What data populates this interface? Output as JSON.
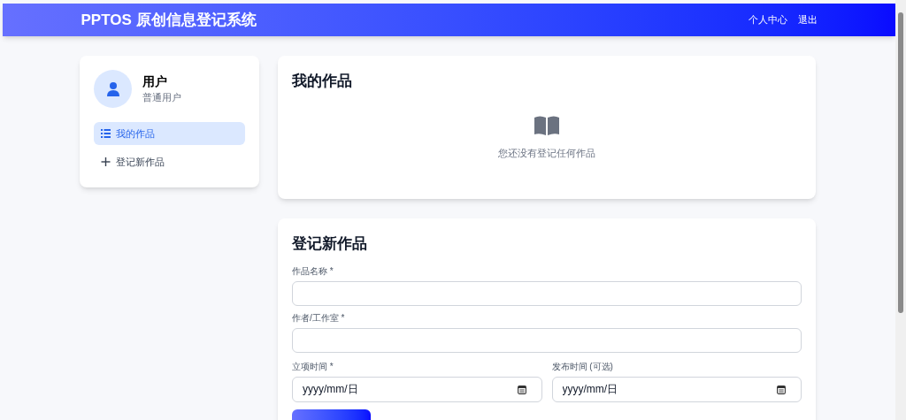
{
  "header": {
    "title": "PPTOS 原创信息登记系统",
    "links": [
      "个人中心",
      "退出"
    ]
  },
  "user": {
    "name": "用户",
    "role": "普通用户"
  },
  "sidebar": {
    "items": [
      {
        "label": "我的作品",
        "kind": "list",
        "selected": true
      },
      {
        "label": "登记新作品",
        "kind": "add",
        "selected": false
      }
    ]
  },
  "works": {
    "title": "我的作品",
    "empty_message": "您还没有登记任何作品"
  },
  "form": {
    "title": "登记新作品",
    "fields": [
      {
        "label": "作品名称 *",
        "kind": "text"
      },
      {
        "label": "作者/工作室 *",
        "kind": "text"
      }
    ],
    "dates": [
      {
        "label": "立项时间 *",
        "placeholder": "yyyy/mm/日"
      },
      {
        "label": "发布时间 (可选)",
        "placeholder": "yyyy/mm/日"
      }
    ]
  }
}
